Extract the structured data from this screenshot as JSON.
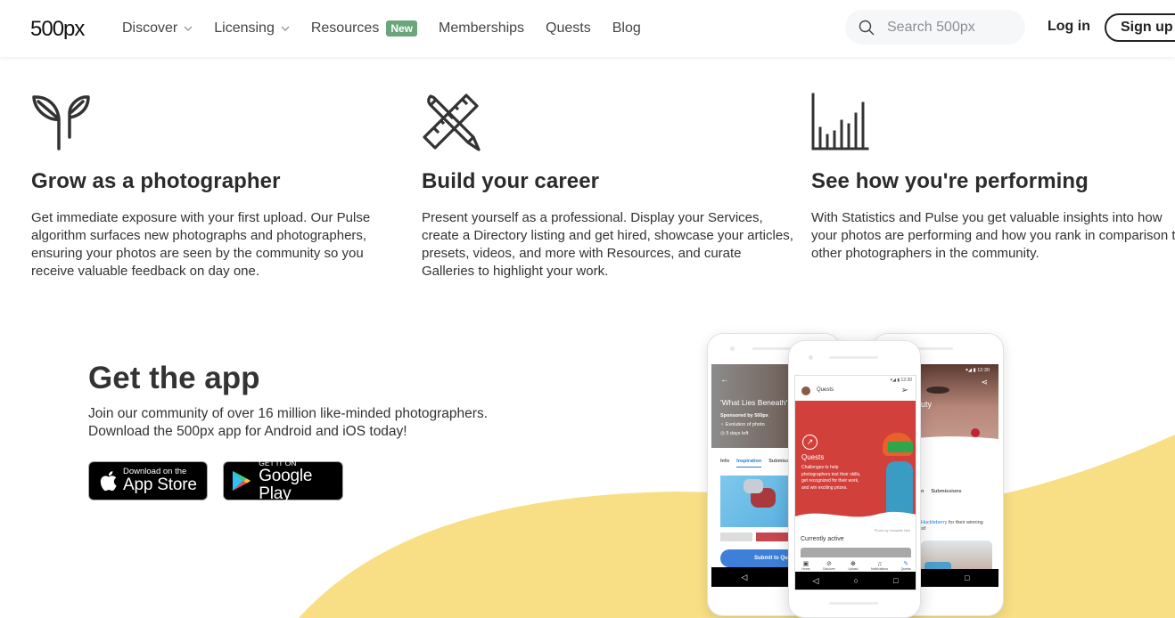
{
  "header": {
    "logo": "500px",
    "nav": [
      {
        "label": "Discover",
        "has_dropdown": true
      },
      {
        "label": "Licensing",
        "has_dropdown": true
      },
      {
        "label": "Resources",
        "badge": "New"
      },
      {
        "label": "Memberships"
      },
      {
        "label": "Quests"
      },
      {
        "label": "Blog"
      }
    ],
    "search_placeholder": "Search 500px",
    "login_label": "Log in",
    "signup_label": "Sign up",
    "badge_color": "#6aa57b"
  },
  "features": [
    {
      "icon": "sprout-icon",
      "title": "Grow as a photographer",
      "text": "Get immediate exposure with your first upload. Our Pulse algorithm surfaces new photographs and photographers, ensuring your photos are seen by the community so you receive valuable feedback on day one."
    },
    {
      "icon": "pencil-ruler-icon",
      "title": "Build your career",
      "text": "Present yourself as a professional. Display your Services, create a Directory listing and get hired, showcase your articles, presets, videos, and more with Resources, and curate Galleries to highlight your work."
    },
    {
      "icon": "bar-chart-icon",
      "title": "See how you're performing",
      "text": "With Statistics and Pulse you get valuable insights into how your photos are performing and how you rank in comparison to other photographers in the community."
    }
  ],
  "app_section": {
    "title": "Get the app",
    "description_line1": "Join our community of over 16 million like-minded photographers.",
    "description_line2": "Download the 500px app for Android and iOS today!",
    "app_store": {
      "small": "Download on the",
      "big": "App Store"
    },
    "google_play": {
      "small": "GET IT ON",
      "big": "Google Play"
    },
    "accent_color": "#f8df86"
  },
  "phones": {
    "left": {
      "title": "'What Lies Beneath'",
      "sponsor": "Sponsored by 500px",
      "prize": "Evolution of photo",
      "time_left": "5 days left",
      "tabs": [
        "Info",
        "Inspiration",
        "Submiss"
      ],
      "submit": "Submit to Qu"
    },
    "center": {
      "status_time": "12:30",
      "header": "Quests",
      "hero_title": "Quests",
      "hero_text": "Challenges to help photographers test their skills, get recognized for their work, and win exciting prizes.",
      "photo_credit": "Photo by Vossette Neil",
      "section": "Currently active",
      "bottom_nav": [
        "Home",
        "Discover",
        "Upload",
        "Notifications",
        "Quests"
      ]
    },
    "right": {
      "status_time": "12:30",
      "title": "uty",
      "tabs": [
        "n",
        "Submissions"
      ],
      "winner_name": "Huckleberry",
      "winner_text": "for their winning",
      "winner_text2": "st!"
    }
  }
}
